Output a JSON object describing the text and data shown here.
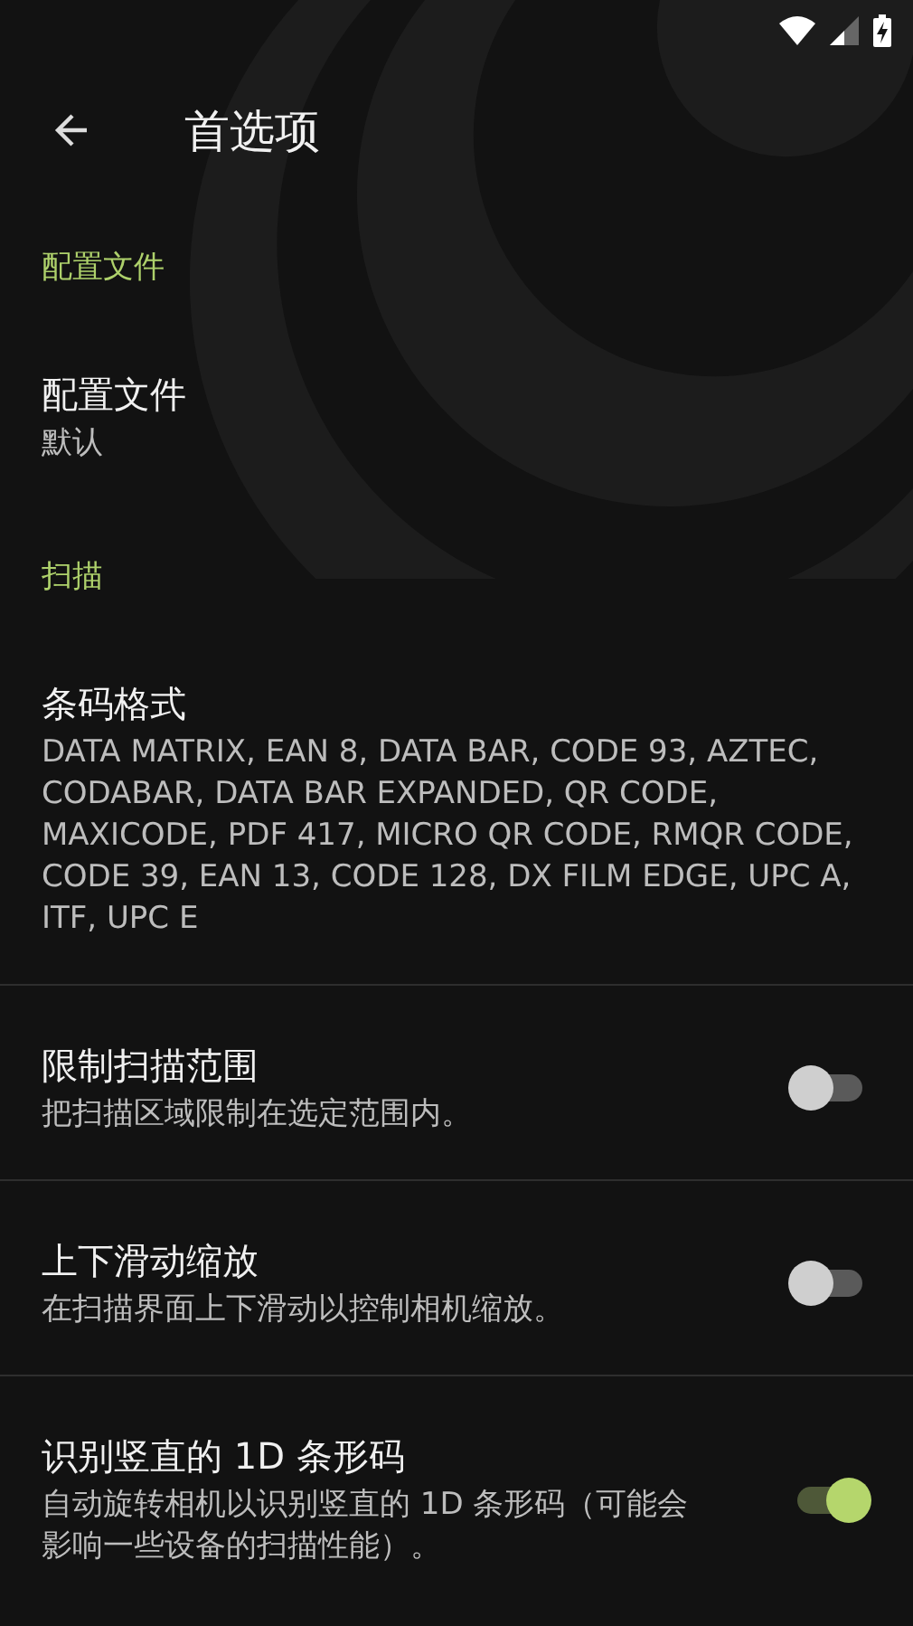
{
  "header": {
    "title": "首选项"
  },
  "sections": [
    {
      "title": "配置文件",
      "items": [
        {
          "kind": "text",
          "title": "配置文件",
          "summary": "默认"
        }
      ]
    },
    {
      "title": "扫描",
      "items": [
        {
          "kind": "text",
          "title": "条码格式",
          "summary": "DATA MATRIX, EAN 8, DATA BAR, CODE 93, AZTEC, CODABAR, DATA BAR EXPANDED, QR CODE, MAXICODE, PDF 417, MICRO QR CODE, RMQR CODE, CODE 39, EAN 13, CODE 128, DX FILM EDGE, UPC A, ITF, UPC E"
        },
        {
          "kind": "switch",
          "title": "限制扫描范围",
          "summary": "把扫描区域限制在选定范围内。",
          "on": false
        },
        {
          "kind": "switch",
          "title": "上下滑动缩放",
          "summary": "在扫描界面上下滑动以控制相机缩放。",
          "on": false
        },
        {
          "kind": "switch",
          "title": "识别竖直的 1D 条形码",
          "summary": "自动旋转相机以识别竖直的 1D 条形码（可能会影响一些设备的扫描性能）。",
          "on": true
        }
      ]
    }
  ]
}
